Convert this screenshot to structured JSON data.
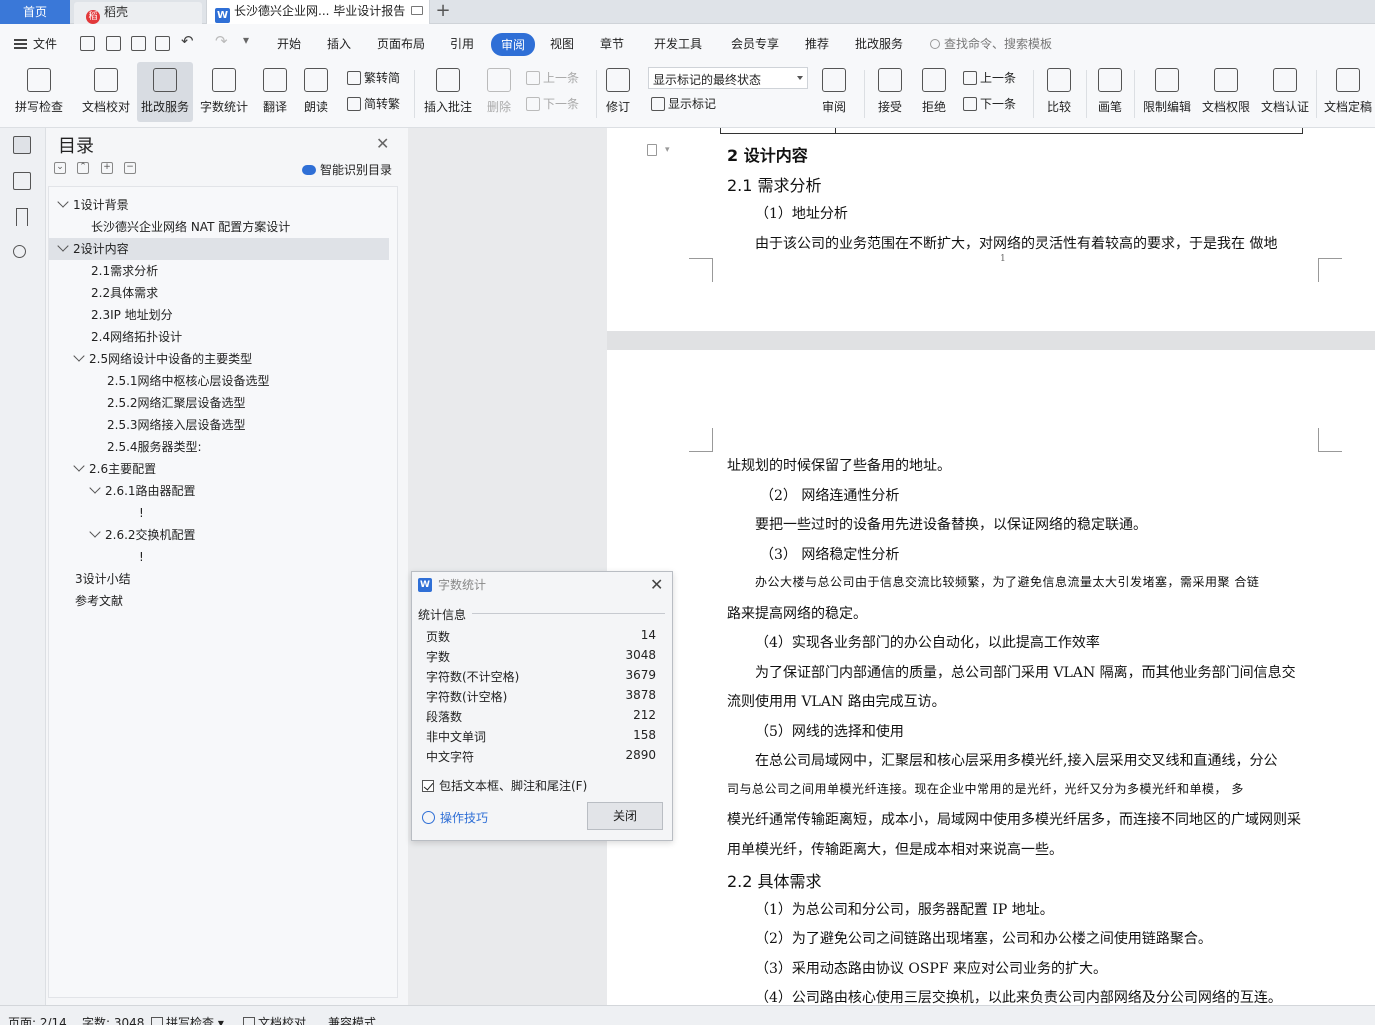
{
  "tabs": {
    "home": "首页",
    "daoke": "稻壳",
    "doc": "长沙德兴企业网... 毕业设计报告",
    "add": "+"
  },
  "menu": {
    "file": "文件",
    "items": [
      "开始",
      "插入",
      "页面布局",
      "引用",
      "审阅",
      "视图",
      "章节",
      "开发工具",
      "会员专享",
      "推荐",
      "批改服务"
    ],
    "active": "审阅",
    "search": "查找命令、搜索模板"
  },
  "ribbon": {
    "spell": "拼写检查",
    "proofread": "文档校对",
    "correction": "批改服务",
    "wordcount": "字数统计",
    "translate": "翻译",
    "read": "朗读",
    "trad": "繁转简",
    "simp": "简转繁",
    "insert_comment": "插入批注",
    "delete": "删除",
    "prev": "上一条",
    "next": "下一条",
    "revise": "修订",
    "markup_state": "显示标记的最终状态",
    "show_markup": "显示标记",
    "review": "审阅",
    "accept": "接受",
    "reject": "拒绝",
    "prev2": "上一条",
    "next2": "下一条",
    "compare": "比较",
    "pen": "画笔",
    "restrict": "限制编辑",
    "perm": "文档权限",
    "auth": "文档认证",
    "final": "文档定稿"
  },
  "toc": {
    "title": "目录",
    "smart": "智能识别目录",
    "items": [
      "1设计背景",
      "长沙德兴企业网络 NAT 配置方案设计",
      "2设计内容",
      "2.1需求分析",
      "2.2具体需求",
      "2.3IP 地址划分",
      "2.4网络拓扑设计",
      "2.5网络设计中设备的主要类型",
      "2.5.1网络中枢核心层设备选型",
      "2.5.2网络汇聚层设备选型",
      "2.5.3网络接入层设备选型",
      "2.5.4服务器类型:",
      "2.6主要配置",
      "2.6.1路由器配置",
      "!",
      "2.6.2交换机配置",
      "!",
      "3设计小结",
      "参考文献"
    ]
  },
  "doc": {
    "h2": "2  设计内容",
    "h21": "2.1 需求分析",
    "p1": "（1）地址分析",
    "p2": "由于该公司的业务范围在不断扩大，对网络的灵活性有着较高的要求，于是我在 做地",
    "pagenum": "1",
    "p3": "址规划的时候保留了些备用的地址。",
    "p4": "（2）  网络连通性分析",
    "p5": "要把一些过时的设备用先进设备替换，以保证网络的稳定联通。",
    "p6": "（3）  网络稳定性分析",
    "p7": "办公大楼与总公司由于信息交流比较频繁，为了避免信息流量太大引发堵塞，需采用聚 合链",
    "p8": "路来提高网络的稳定。",
    "p9": "（4）实现各业务部门的办公自动化，以此提高工作效率",
    "p10": "为了保证部门内部通信的质量，总公司部门采用 VLAN 隔离，而其他业务部门间信息交",
    "p11": "流则使用用 VLAN 路由完成互访。",
    "p12": "（5）网线的选择和使用",
    "p13": "在总公司局域网中，汇聚层和核心层采用多模光纤,接入层采用交叉线和直通线，分公",
    "p14": "司与总公司之间用单模光纤连接。现在企业中常用的是光纤，光纤又分为多模光纤和单模，  多",
    "p15": "模光纤通常传输距离短，成本小，局域网中使用多模光纤居多，而连接不同地区的广域网则采",
    "p16": "用单模光纤，传输距离大，但是成本相对来说高一些。",
    "h22": "2.2 具体需求",
    "p17": "（1）为总公司和分公司，服务器配置 IP 地址。",
    "p18": "（2）为了避免公司之间链路出现堵塞，公司和办公楼之间使用链路聚合。",
    "p19": "（3）采用动态路由协议 OSPF 来应对公司业务的扩大。",
    "p20": "（4）公司路由核心使用三层交换机，以此来负责公司内部网络及分公司网络的互连。"
  },
  "dialog": {
    "title": "字数统计",
    "section": "统计信息",
    "stats": [
      {
        "label": "页数",
        "value": "14"
      },
      {
        "label": "字数",
        "value": "3048"
      },
      {
        "label": "字符数(不计空格)",
        "value": "3679"
      },
      {
        "label": "字符数(计空格)",
        "value": "3878"
      },
      {
        "label": "段落数",
        "value": "212"
      },
      {
        "label": "非中文单词",
        "value": "158"
      },
      {
        "label": "中文字符",
        "value": "2890"
      }
    ],
    "include": "包括文本框、脚注和尾注(F)",
    "tips": "操作技巧",
    "close": "关闭"
  },
  "status": {
    "page": "页面: 2/14",
    "words": "字数: 3048",
    "spell": "拼写检查",
    "proof": "文档校对",
    "compat": "兼容模式"
  },
  "colors": {
    "accent": "#2f6fd6",
    "tab_home": "#3a78d8",
    "daoke": "#e2383a"
  }
}
